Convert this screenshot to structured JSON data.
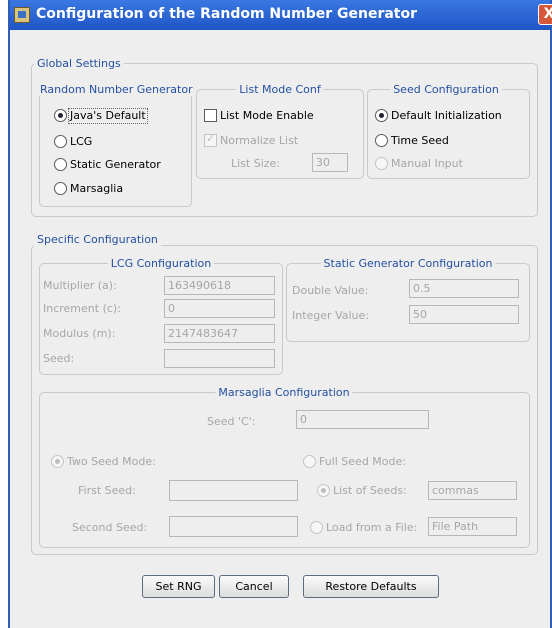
{
  "window": {
    "title": "Configuration of the Random Number Generator",
    "close_symbol": "X"
  },
  "global": {
    "legend": "Global Settings",
    "rng": {
      "legend": "Random Number Generator",
      "options": [
        "Java's Default",
        "LCG",
        "Static Generator",
        "Marsaglia"
      ],
      "selected": "Java's Default"
    },
    "list_mode": {
      "legend": "List Mode Conf",
      "enable_label": "List Mode Enable",
      "normalize_label": "Normalize List",
      "size_label": "List Size:",
      "size_value": "30"
    },
    "seed": {
      "legend": "Seed Configuration",
      "options": [
        "Default Initialization",
        "Time Seed",
        "Manual Input"
      ],
      "selected": "Default Initialization"
    }
  },
  "specific": {
    "legend": "Specific Configuration",
    "lcg": {
      "legend": "LCG Configuration",
      "multiplier_label": "Multiplier (a):",
      "multiplier_value": "163490618",
      "increment_label": "Increment (c):",
      "increment_value": "0",
      "modulus_label": "Modulus (m):",
      "modulus_value": "2147483647",
      "seed_label": "Seed:",
      "seed_value": ""
    },
    "static": {
      "legend": "Static Generator Configuration",
      "double_label": "Double Value:",
      "double_value": "0.5",
      "integer_label": "Integer Value:",
      "integer_value": "50"
    },
    "marsaglia": {
      "legend": "Marsaglia Configuration",
      "seed_c_label": "Seed 'C':",
      "seed_c_value": "0",
      "two_seed_label": "Two Seed Mode:",
      "first_seed_label": "First Seed:",
      "first_seed_value": "",
      "second_seed_label": "Second Seed:",
      "second_seed_value": "",
      "full_seed_label": "Full Seed Mode:",
      "list_of_seeds_label": "List of Seeds:",
      "list_of_seeds_value": "commas",
      "load_file_label": "Load from a File:",
      "load_file_value": "File Path"
    }
  },
  "buttons": {
    "set_rng": "Set RNG",
    "cancel": "Cancel",
    "restore": "Restore Defaults"
  }
}
